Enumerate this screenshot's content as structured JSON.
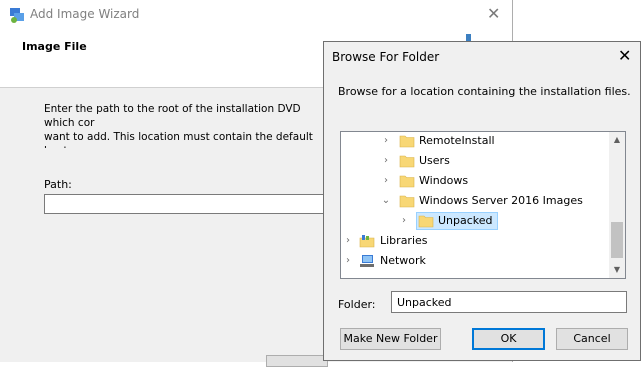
{
  "wizard": {
    "title": "Add Image Wizard",
    "page_title": "Image File",
    "description": "Enter the path to the root of the installation DVD which cor\nwant to add. This location must contain the default boot ar\nand Install.wim). It cannot contain a custom image.",
    "path_label": "Path:",
    "path_value": ""
  },
  "dialog": {
    "title": "Browse For Folder",
    "description": "Browse for a location containing the installation files.",
    "tree": [
      {
        "label": "RemoteInstall",
        "icon": "folder-icon",
        "expander": "collapsed"
      },
      {
        "label": "Users",
        "icon": "folder-icon",
        "expander": "collapsed"
      },
      {
        "label": "Windows",
        "icon": "folder-icon",
        "expander": "collapsed"
      },
      {
        "label": "Windows Server 2016 Images",
        "icon": "folder-icon",
        "expander": "expanded"
      },
      {
        "label": "Unpacked",
        "icon": "folder-icon",
        "expander": "collapsed",
        "selected": true
      },
      {
        "label": "Libraries",
        "icon": "libraries-icon",
        "expander": "collapsed"
      },
      {
        "label": "Network",
        "icon": "network-icon",
        "expander": "collapsed"
      }
    ],
    "folder_label": "Folder:",
    "folder_value": "Unpacked",
    "buttons": {
      "make_new_folder": "Make New Folder",
      "ok": "OK",
      "cancel": "Cancel"
    }
  },
  "colors": {
    "accent": "#0078d7",
    "selection_bg": "#cce8ff",
    "folder": "#f8d775"
  }
}
